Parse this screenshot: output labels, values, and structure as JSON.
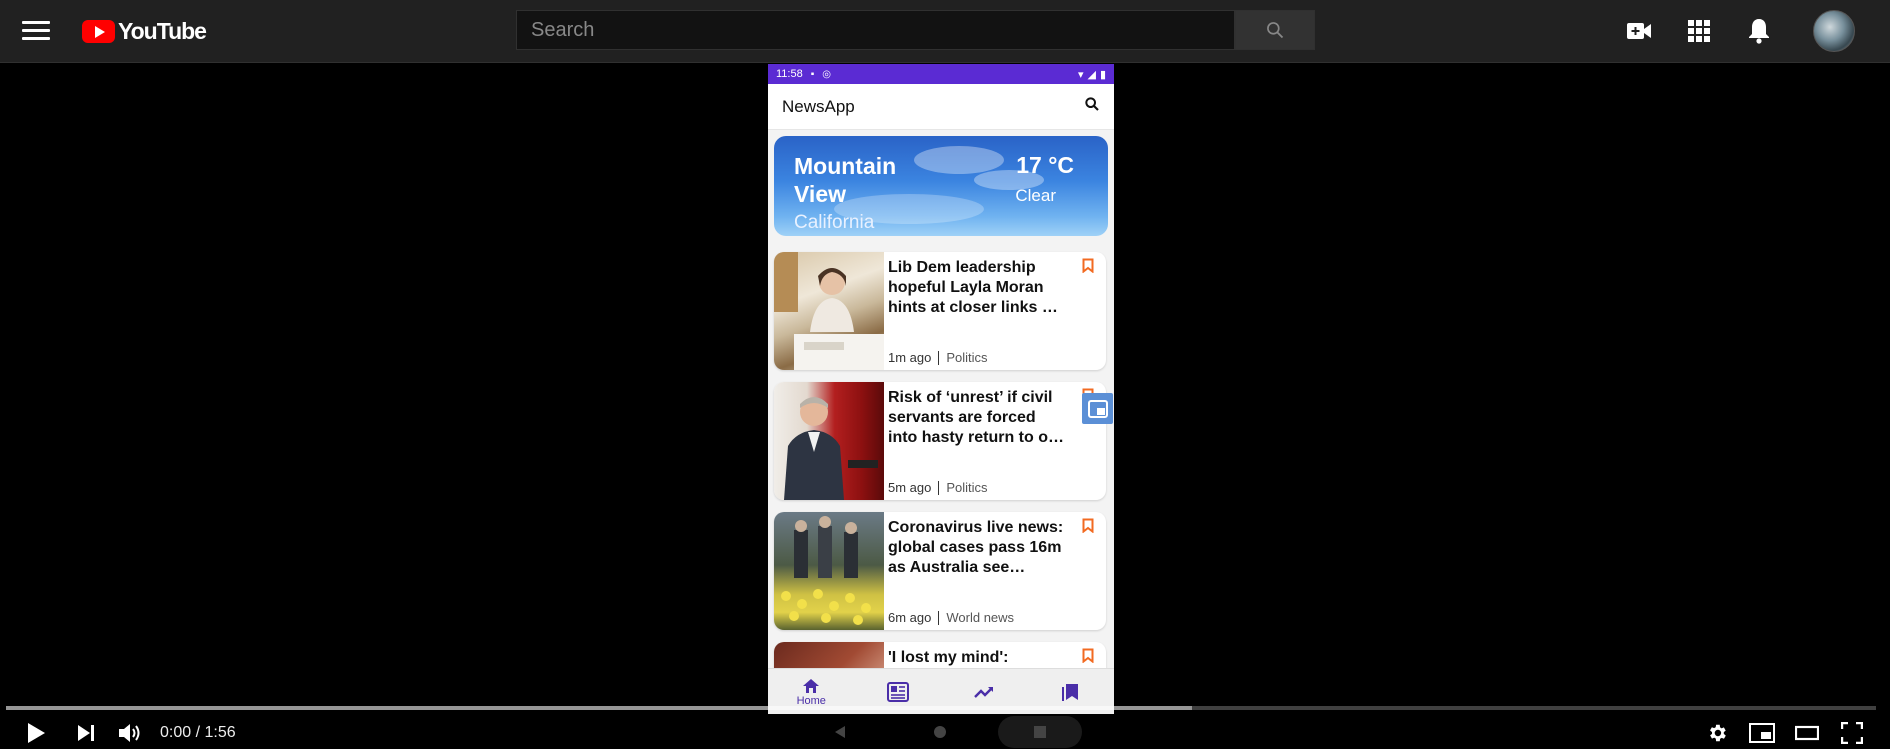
{
  "youtube": {
    "brand": "YouTube",
    "search_placeholder": "Search",
    "icons": [
      "menu-icon",
      "youtube-logo",
      "search-icon",
      "create-video-icon",
      "apps-grid-icon",
      "notifications-bell-icon",
      "account-avatar"
    ]
  },
  "phone": {
    "status": {
      "time": "11:58"
    },
    "app_title": "NewsApp",
    "weather": {
      "city": "Mountain View",
      "region": "California",
      "temperature": "17 °C",
      "condition": "Clear"
    },
    "articles": [
      {
        "headline": "Lib Dem leadership hopeful Layla Moran hints at closer links …",
        "time": "1m ago",
        "category": "Politics"
      },
      {
        "headline": "Risk of ‘unrest’ if civil servants are forced into hasty return to o…",
        "time": "5m ago",
        "category": "Politics"
      },
      {
        "headline": "Coronavirus live news: global cases pass 16m as Australia see…",
        "time": "6m ago",
        "category": "World news"
      },
      {
        "headline": "'I lost my mind':",
        "time": "",
        "category": ""
      }
    ],
    "bottom_nav": [
      {
        "label": "Home",
        "icon": "home-icon",
        "active": true
      },
      {
        "label": "",
        "icon": "newspaper-icon",
        "active": false
      },
      {
        "label": "",
        "icon": "trending-icon",
        "active": false
      },
      {
        "label": "",
        "icon": "bookmarks-icon",
        "active": false
      }
    ]
  },
  "player": {
    "current_time": "0:00",
    "duration": "1:56",
    "time_display": "0:00 / 1:56",
    "played_fraction": 0.0,
    "buffered_fraction": 0.634
  },
  "colors": {
    "topbar": "#212121",
    "status_bar": "#5b2bd3",
    "bookmark_accent": "#f26a21",
    "nav_accent": "#4a2ea8"
  }
}
